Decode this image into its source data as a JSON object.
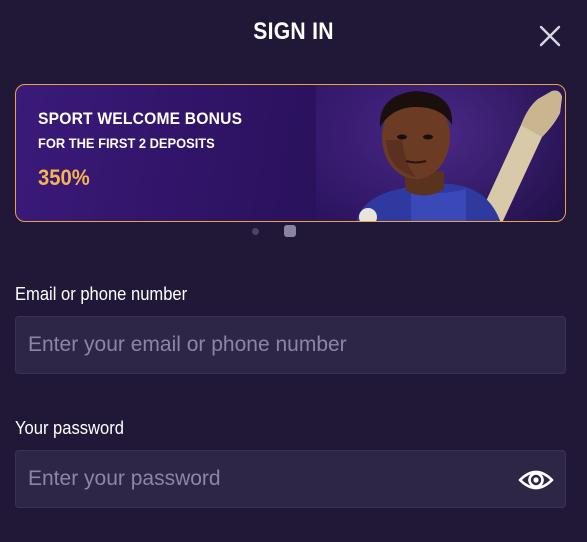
{
  "modal": {
    "title": "SIGN IN"
  },
  "banner": {
    "title": "SPORT WELCOME BONUS",
    "subtitle": "FOR THE FIRST 2 DEPOSITS",
    "percent": "350%",
    "slides_total": 2,
    "active_slide": 2
  },
  "form": {
    "email_label": "Email or phone number",
    "email_placeholder": "Enter your email or phone number",
    "email_value": "",
    "password_label": "Your password",
    "password_placeholder": "Enter your password",
    "password_value": ""
  },
  "icons": {
    "close": "close-icon",
    "password_toggle": "eye-icon"
  },
  "colors": {
    "background": "#211838",
    "banner_border": "#e7a546",
    "accent_percent": "#f4b452",
    "field_background": "#2e2647",
    "placeholder": "#8c86a3"
  }
}
